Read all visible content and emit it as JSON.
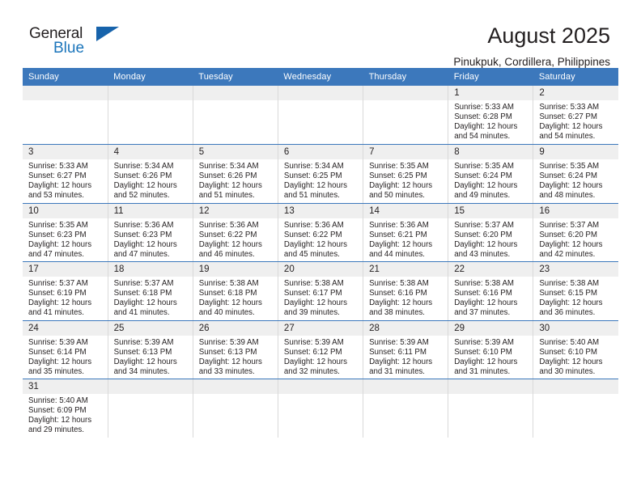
{
  "brand": {
    "name_part1": "General",
    "name_part2": "Blue",
    "triangle_color": "#1763ab",
    "blue_color": "#1b75bb"
  },
  "header": {
    "title": "August 2025",
    "subtitle": "Pinukpuk, Cordillera, Philippines"
  },
  "theme": {
    "header_bar_color": "#3c78bc",
    "daynum_bg": "#efefef",
    "row_border": "#3c78bc",
    "col_border": "#d9d9d9"
  },
  "weekday_headers": [
    "Sunday",
    "Monday",
    "Tuesday",
    "Wednesday",
    "Thursday",
    "Friday",
    "Saturday"
  ],
  "weeks": [
    [
      {
        "day": "",
        "lines": []
      },
      {
        "day": "",
        "lines": []
      },
      {
        "day": "",
        "lines": []
      },
      {
        "day": "",
        "lines": []
      },
      {
        "day": "",
        "lines": []
      },
      {
        "day": "1",
        "lines": [
          "Sunrise: 5:33 AM",
          "Sunset: 6:28 PM",
          "Daylight: 12 hours",
          "and 54 minutes."
        ]
      },
      {
        "day": "2",
        "lines": [
          "Sunrise: 5:33 AM",
          "Sunset: 6:27 PM",
          "Daylight: 12 hours",
          "and 54 minutes."
        ]
      }
    ],
    [
      {
        "day": "3",
        "lines": [
          "Sunrise: 5:33 AM",
          "Sunset: 6:27 PM",
          "Daylight: 12 hours",
          "and 53 minutes."
        ]
      },
      {
        "day": "4",
        "lines": [
          "Sunrise: 5:34 AM",
          "Sunset: 6:26 PM",
          "Daylight: 12 hours",
          "and 52 minutes."
        ]
      },
      {
        "day": "5",
        "lines": [
          "Sunrise: 5:34 AM",
          "Sunset: 6:26 PM",
          "Daylight: 12 hours",
          "and 51 minutes."
        ]
      },
      {
        "day": "6",
        "lines": [
          "Sunrise: 5:34 AM",
          "Sunset: 6:25 PM",
          "Daylight: 12 hours",
          "and 51 minutes."
        ]
      },
      {
        "day": "7",
        "lines": [
          "Sunrise: 5:35 AM",
          "Sunset: 6:25 PM",
          "Daylight: 12 hours",
          "and 50 minutes."
        ]
      },
      {
        "day": "8",
        "lines": [
          "Sunrise: 5:35 AM",
          "Sunset: 6:24 PM",
          "Daylight: 12 hours",
          "and 49 minutes."
        ]
      },
      {
        "day": "9",
        "lines": [
          "Sunrise: 5:35 AM",
          "Sunset: 6:24 PM",
          "Daylight: 12 hours",
          "and 48 minutes."
        ]
      }
    ],
    [
      {
        "day": "10",
        "lines": [
          "Sunrise: 5:35 AM",
          "Sunset: 6:23 PM",
          "Daylight: 12 hours",
          "and 47 minutes."
        ]
      },
      {
        "day": "11",
        "lines": [
          "Sunrise: 5:36 AM",
          "Sunset: 6:23 PM",
          "Daylight: 12 hours",
          "and 47 minutes."
        ]
      },
      {
        "day": "12",
        "lines": [
          "Sunrise: 5:36 AM",
          "Sunset: 6:22 PM",
          "Daylight: 12 hours",
          "and 46 minutes."
        ]
      },
      {
        "day": "13",
        "lines": [
          "Sunrise: 5:36 AM",
          "Sunset: 6:22 PM",
          "Daylight: 12 hours",
          "and 45 minutes."
        ]
      },
      {
        "day": "14",
        "lines": [
          "Sunrise: 5:36 AM",
          "Sunset: 6:21 PM",
          "Daylight: 12 hours",
          "and 44 minutes."
        ]
      },
      {
        "day": "15",
        "lines": [
          "Sunrise: 5:37 AM",
          "Sunset: 6:20 PM",
          "Daylight: 12 hours",
          "and 43 minutes."
        ]
      },
      {
        "day": "16",
        "lines": [
          "Sunrise: 5:37 AM",
          "Sunset: 6:20 PM",
          "Daylight: 12 hours",
          "and 42 minutes."
        ]
      }
    ],
    [
      {
        "day": "17",
        "lines": [
          "Sunrise: 5:37 AM",
          "Sunset: 6:19 PM",
          "Daylight: 12 hours",
          "and 41 minutes."
        ]
      },
      {
        "day": "18",
        "lines": [
          "Sunrise: 5:37 AM",
          "Sunset: 6:18 PM",
          "Daylight: 12 hours",
          "and 41 minutes."
        ]
      },
      {
        "day": "19",
        "lines": [
          "Sunrise: 5:38 AM",
          "Sunset: 6:18 PM",
          "Daylight: 12 hours",
          "and 40 minutes."
        ]
      },
      {
        "day": "20",
        "lines": [
          "Sunrise: 5:38 AM",
          "Sunset: 6:17 PM",
          "Daylight: 12 hours",
          "and 39 minutes."
        ]
      },
      {
        "day": "21",
        "lines": [
          "Sunrise: 5:38 AM",
          "Sunset: 6:16 PM",
          "Daylight: 12 hours",
          "and 38 minutes."
        ]
      },
      {
        "day": "22",
        "lines": [
          "Sunrise: 5:38 AM",
          "Sunset: 6:16 PM",
          "Daylight: 12 hours",
          "and 37 minutes."
        ]
      },
      {
        "day": "23",
        "lines": [
          "Sunrise: 5:38 AM",
          "Sunset: 6:15 PM",
          "Daylight: 12 hours",
          "and 36 minutes."
        ]
      }
    ],
    [
      {
        "day": "24",
        "lines": [
          "Sunrise: 5:39 AM",
          "Sunset: 6:14 PM",
          "Daylight: 12 hours",
          "and 35 minutes."
        ]
      },
      {
        "day": "25",
        "lines": [
          "Sunrise: 5:39 AM",
          "Sunset: 6:13 PM",
          "Daylight: 12 hours",
          "and 34 minutes."
        ]
      },
      {
        "day": "26",
        "lines": [
          "Sunrise: 5:39 AM",
          "Sunset: 6:13 PM",
          "Daylight: 12 hours",
          "and 33 minutes."
        ]
      },
      {
        "day": "27",
        "lines": [
          "Sunrise: 5:39 AM",
          "Sunset: 6:12 PM",
          "Daylight: 12 hours",
          "and 32 minutes."
        ]
      },
      {
        "day": "28",
        "lines": [
          "Sunrise: 5:39 AM",
          "Sunset: 6:11 PM",
          "Daylight: 12 hours",
          "and 31 minutes."
        ]
      },
      {
        "day": "29",
        "lines": [
          "Sunrise: 5:39 AM",
          "Sunset: 6:10 PM",
          "Daylight: 12 hours",
          "and 31 minutes."
        ]
      },
      {
        "day": "30",
        "lines": [
          "Sunrise: 5:40 AM",
          "Sunset: 6:10 PM",
          "Daylight: 12 hours",
          "and 30 minutes."
        ]
      }
    ],
    [
      {
        "day": "31",
        "lines": [
          "Sunrise: 5:40 AM",
          "Sunset: 6:09 PM",
          "Daylight: 12 hours",
          "and 29 minutes."
        ]
      },
      {
        "day": "",
        "lines": []
      },
      {
        "day": "",
        "lines": []
      },
      {
        "day": "",
        "lines": []
      },
      {
        "day": "",
        "lines": []
      },
      {
        "day": "",
        "lines": []
      },
      {
        "day": "",
        "lines": []
      }
    ]
  ]
}
